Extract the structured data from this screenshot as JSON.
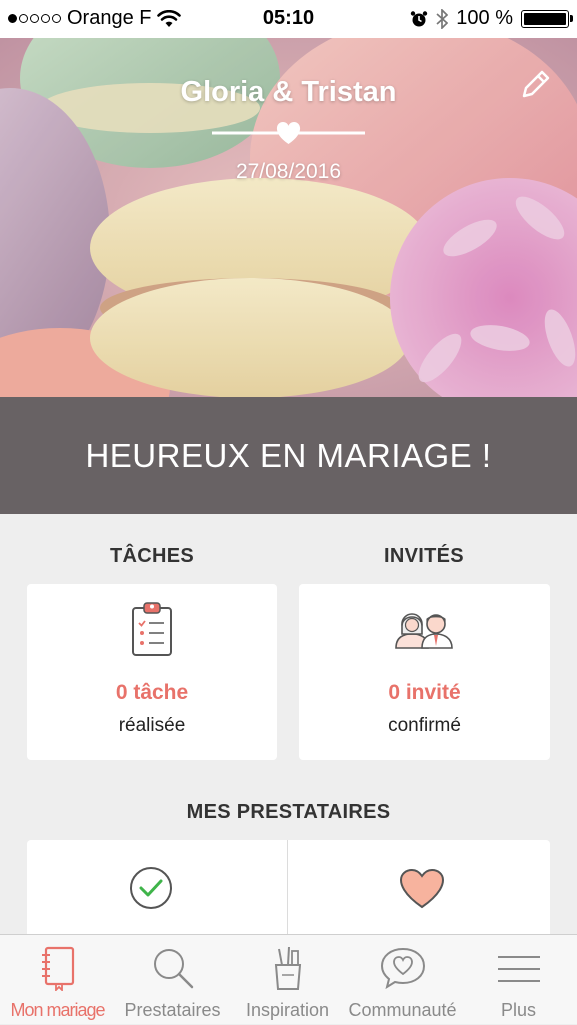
{
  "status_bar": {
    "carrier": "Orange F",
    "time": "05:10",
    "battery": "100 %"
  },
  "hero": {
    "names": "Gloria & Tristan",
    "date": "27/08/2016"
  },
  "banner": {
    "text": "HEUREUX EN MARIAGE !"
  },
  "tasks": {
    "title": "TÂCHES",
    "count": "0 tâche",
    "sub": "réalisée"
  },
  "guests": {
    "title": "INVITÉS",
    "count": "0 invité",
    "sub": "confirmé"
  },
  "vendors": {
    "title": "MES PRESTATAIRES"
  },
  "tabs": [
    {
      "label": "Mon mariage",
      "icon": "notebook-icon",
      "active": true
    },
    {
      "label": "Prestataires",
      "icon": "search-icon",
      "active": false
    },
    {
      "label": "Inspiration",
      "icon": "pencil-cup-icon",
      "active": false
    },
    {
      "label": "Communauté",
      "icon": "chat-heart-icon",
      "active": false
    },
    {
      "label": "Plus",
      "icon": "menu-icon",
      "active": false
    }
  ],
  "colors": {
    "accent": "#e8726a",
    "banner": "#686264",
    "background": "#eeeeee"
  }
}
